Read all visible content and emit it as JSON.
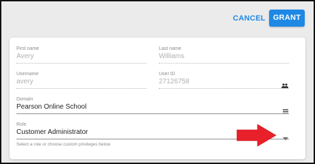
{
  "dialog": {
    "cancel_label": "CANCEL",
    "grant_label": "GRANT",
    "accent_color": "#1e88e5"
  },
  "form": {
    "first_name": {
      "label": "First name",
      "value": "Avery"
    },
    "last_name": {
      "label": "Last name",
      "value": "Williams"
    },
    "username": {
      "label": "Username",
      "value": "avery"
    },
    "user_id": {
      "label": "User ID",
      "value": "27126758",
      "icon": "people-icon"
    },
    "domain": {
      "label": "Domain",
      "value": "Pearson Online School",
      "icon": "list-icon"
    },
    "role": {
      "label": "Role",
      "value": "Customer Administrator",
      "icon": "dropdown-arrow-icon",
      "helper_text": "Select a role or choose custom privileges below"
    }
  },
  "annotation": {
    "icon": "red-arrow-icon",
    "color": "#e8202a"
  }
}
